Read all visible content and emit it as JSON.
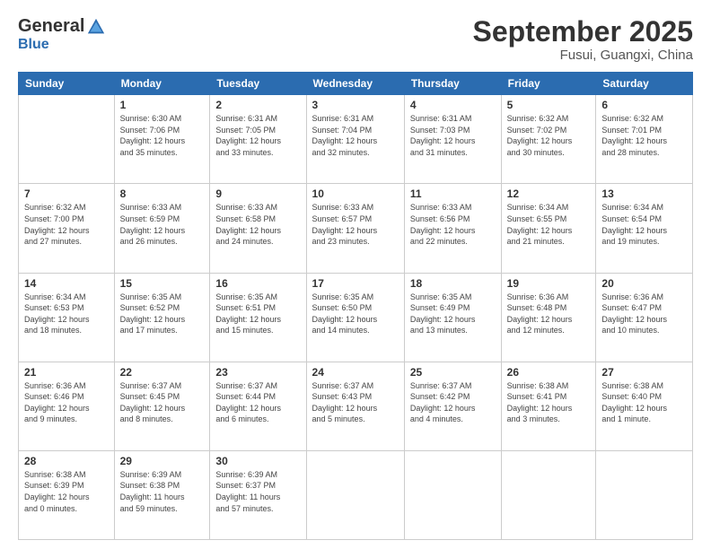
{
  "header": {
    "logo_general": "General",
    "logo_blue": "Blue",
    "month_title": "September 2025",
    "location": "Fusui, Guangxi, China"
  },
  "weekdays": [
    "Sunday",
    "Monday",
    "Tuesday",
    "Wednesday",
    "Thursday",
    "Friday",
    "Saturday"
  ],
  "weeks": [
    [
      {
        "day": "",
        "info": ""
      },
      {
        "day": "1",
        "info": "Sunrise: 6:30 AM\nSunset: 7:06 PM\nDaylight: 12 hours\nand 35 minutes."
      },
      {
        "day": "2",
        "info": "Sunrise: 6:31 AM\nSunset: 7:05 PM\nDaylight: 12 hours\nand 33 minutes."
      },
      {
        "day": "3",
        "info": "Sunrise: 6:31 AM\nSunset: 7:04 PM\nDaylight: 12 hours\nand 32 minutes."
      },
      {
        "day": "4",
        "info": "Sunrise: 6:31 AM\nSunset: 7:03 PM\nDaylight: 12 hours\nand 31 minutes."
      },
      {
        "day": "5",
        "info": "Sunrise: 6:32 AM\nSunset: 7:02 PM\nDaylight: 12 hours\nand 30 minutes."
      },
      {
        "day": "6",
        "info": "Sunrise: 6:32 AM\nSunset: 7:01 PM\nDaylight: 12 hours\nand 28 minutes."
      }
    ],
    [
      {
        "day": "7",
        "info": "Sunrise: 6:32 AM\nSunset: 7:00 PM\nDaylight: 12 hours\nand 27 minutes."
      },
      {
        "day": "8",
        "info": "Sunrise: 6:33 AM\nSunset: 6:59 PM\nDaylight: 12 hours\nand 26 minutes."
      },
      {
        "day": "9",
        "info": "Sunrise: 6:33 AM\nSunset: 6:58 PM\nDaylight: 12 hours\nand 24 minutes."
      },
      {
        "day": "10",
        "info": "Sunrise: 6:33 AM\nSunset: 6:57 PM\nDaylight: 12 hours\nand 23 minutes."
      },
      {
        "day": "11",
        "info": "Sunrise: 6:33 AM\nSunset: 6:56 PM\nDaylight: 12 hours\nand 22 minutes."
      },
      {
        "day": "12",
        "info": "Sunrise: 6:34 AM\nSunset: 6:55 PM\nDaylight: 12 hours\nand 21 minutes."
      },
      {
        "day": "13",
        "info": "Sunrise: 6:34 AM\nSunset: 6:54 PM\nDaylight: 12 hours\nand 19 minutes."
      }
    ],
    [
      {
        "day": "14",
        "info": "Sunrise: 6:34 AM\nSunset: 6:53 PM\nDaylight: 12 hours\nand 18 minutes."
      },
      {
        "day": "15",
        "info": "Sunrise: 6:35 AM\nSunset: 6:52 PM\nDaylight: 12 hours\nand 17 minutes."
      },
      {
        "day": "16",
        "info": "Sunrise: 6:35 AM\nSunset: 6:51 PM\nDaylight: 12 hours\nand 15 minutes."
      },
      {
        "day": "17",
        "info": "Sunrise: 6:35 AM\nSunset: 6:50 PM\nDaylight: 12 hours\nand 14 minutes."
      },
      {
        "day": "18",
        "info": "Sunrise: 6:35 AM\nSunset: 6:49 PM\nDaylight: 12 hours\nand 13 minutes."
      },
      {
        "day": "19",
        "info": "Sunrise: 6:36 AM\nSunset: 6:48 PM\nDaylight: 12 hours\nand 12 minutes."
      },
      {
        "day": "20",
        "info": "Sunrise: 6:36 AM\nSunset: 6:47 PM\nDaylight: 12 hours\nand 10 minutes."
      }
    ],
    [
      {
        "day": "21",
        "info": "Sunrise: 6:36 AM\nSunset: 6:46 PM\nDaylight: 12 hours\nand 9 minutes."
      },
      {
        "day": "22",
        "info": "Sunrise: 6:37 AM\nSunset: 6:45 PM\nDaylight: 12 hours\nand 8 minutes."
      },
      {
        "day": "23",
        "info": "Sunrise: 6:37 AM\nSunset: 6:44 PM\nDaylight: 12 hours\nand 6 minutes."
      },
      {
        "day": "24",
        "info": "Sunrise: 6:37 AM\nSunset: 6:43 PM\nDaylight: 12 hours\nand 5 minutes."
      },
      {
        "day": "25",
        "info": "Sunrise: 6:37 AM\nSunset: 6:42 PM\nDaylight: 12 hours\nand 4 minutes."
      },
      {
        "day": "26",
        "info": "Sunrise: 6:38 AM\nSunset: 6:41 PM\nDaylight: 12 hours\nand 3 minutes."
      },
      {
        "day": "27",
        "info": "Sunrise: 6:38 AM\nSunset: 6:40 PM\nDaylight: 12 hours\nand 1 minute."
      }
    ],
    [
      {
        "day": "28",
        "info": "Sunrise: 6:38 AM\nSunset: 6:39 PM\nDaylight: 12 hours\nand 0 minutes."
      },
      {
        "day": "29",
        "info": "Sunrise: 6:39 AM\nSunset: 6:38 PM\nDaylight: 11 hours\nand 59 minutes."
      },
      {
        "day": "30",
        "info": "Sunrise: 6:39 AM\nSunset: 6:37 PM\nDaylight: 11 hours\nand 57 minutes."
      },
      {
        "day": "",
        "info": ""
      },
      {
        "day": "",
        "info": ""
      },
      {
        "day": "",
        "info": ""
      },
      {
        "day": "",
        "info": ""
      }
    ]
  ]
}
